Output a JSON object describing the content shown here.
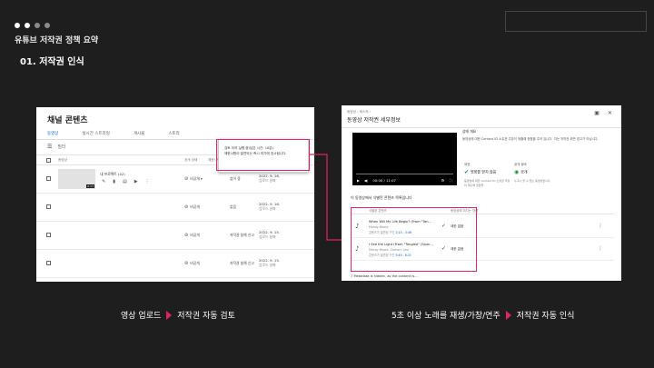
{
  "header": {
    "subtitle": "유튜브 저작권 정책 요약",
    "section": "01. 저작권 인식"
  },
  "colors": {
    "accent": "#e0245e",
    "link": "#065fd4",
    "ok": "#1e8e3e"
  },
  "left_panel": {
    "title": "채널 콘텐츠",
    "tabs": [
      "동영상",
      "실시간 스트리밍",
      "게시물",
      "스토리"
    ],
    "filter_label": "필터",
    "columns": {
      "video": "동영상",
      "visibility": "공개 상태",
      "restrictions": "제한사항",
      "date": "날짜"
    },
    "rows": [
      {
        "title": "내 프로젝트 (42)",
        "duration": "0:17",
        "visibility": "비공개",
        "restriction": "없어 중",
        "date": "2022. 9. 16.",
        "date_sub": "업로드 날짜"
      },
      {
        "visibility": "비공개",
        "restriction": "없음",
        "date": "2022. 9. 16.",
        "date_sub": "업로드 날짜"
      },
      {
        "visibility": "비공개",
        "restriction": "저작권 침해 신고",
        "date": "2022. 9. 15.",
        "date_sub": "업로드 날짜"
      },
      {
        "visibility": "비공개",
        "restriction": "저작권 침해 신고",
        "date": "2022. 9. 15.",
        "date_sub": "업로드 날짜"
      }
    ],
    "popup_line1": "검토 이어 실행 중(남은 시간: 10분)",
    "popup_line2": "제한사항이 발견되는 즉시 여기에 표시됩니다."
  },
  "right_panel": {
    "crumb": "동영상 › 제스처 ›",
    "title": "동영상 저작권 세부정보",
    "player_time": "00:00 / 11:07",
    "info_heading": "상태 개요",
    "info_text": "동영상에 대한 Content ID 소유권 주장이 제출해 정합을 주어 입니다. 지는 저작권 위반 경고가 아닙니다.",
    "status1_label": "제표",
    "status1_value": "영향을 받지 않음",
    "status1_desc": "동영상에 대한 Content ID 소유권 주장이 제출해 정합을",
    "status2_label": "공개 상태",
    "status2_value": "공개",
    "status2_desc": "누구나 볼 수 있는 동영상입니다",
    "section_title": "이 동영상에서 식별된 콘텐츠 목록입니다",
    "col_content": "식별된 콘텐츠",
    "col_effect": "동영상에 미치는 영향",
    "songs": [
      {
        "title": "When Will My Life Begin? (From \"Tan...",
        "artist": "Mandy Moore",
        "usage": "콘텐츠가 발견된 구간 ",
        "range": "2:14 - 3:46",
        "status": "제한 없음"
      },
      {
        "title": "I See the Light (From \"Tangled\" (Soun...",
        "artist": "Mandy Moore, Zachary Levi",
        "usage": "콘텐츠가 발견된 구간 ",
        "range": "5:40 - 6:21",
        "status": "제한 없음"
      }
    ],
    "meta_text": "Metadata is hidden, as the content is..."
  },
  "captions": {
    "left_a": "영상 업로드",
    "left_b": "저작권 자동 검토",
    "right_a": "5초 이상 노래를 재생/가창/연주",
    "right_b": "저작권 자동 인식"
  }
}
